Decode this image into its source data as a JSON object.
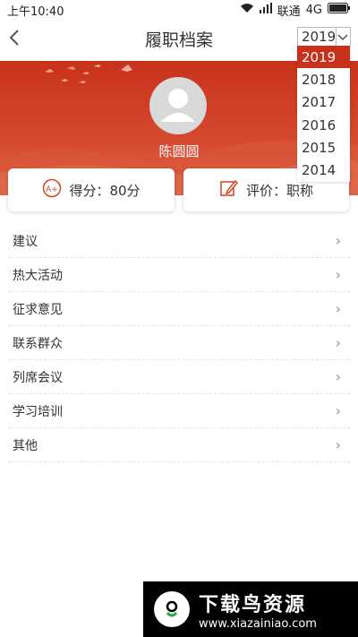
{
  "status": {
    "time": "上午10:40",
    "carrier": "联通",
    "network": "4G"
  },
  "nav": {
    "title": "履职档案",
    "selected_year": "2019"
  },
  "profile": {
    "name": "陈圆圆"
  },
  "stats": {
    "score_label": "得分：80分",
    "score_icon_text": "A+",
    "evaluation_label": "评价：职称"
  },
  "menu": [
    {
      "label": "建议"
    },
    {
      "label": "热大活动"
    },
    {
      "label": "征求意见"
    },
    {
      "label": "联系群众"
    },
    {
      "label": "列席会议"
    },
    {
      "label": "学习培训"
    },
    {
      "label": "其他"
    }
  ],
  "year_options": [
    "2019",
    "2018",
    "2017",
    "2016",
    "2015",
    "2014"
  ],
  "watermark": {
    "title": "下载鸟资源",
    "url": "www.xiazainiao.com"
  },
  "colors": {
    "accent": "#c8321d",
    "card_icon": "#d0451f"
  }
}
